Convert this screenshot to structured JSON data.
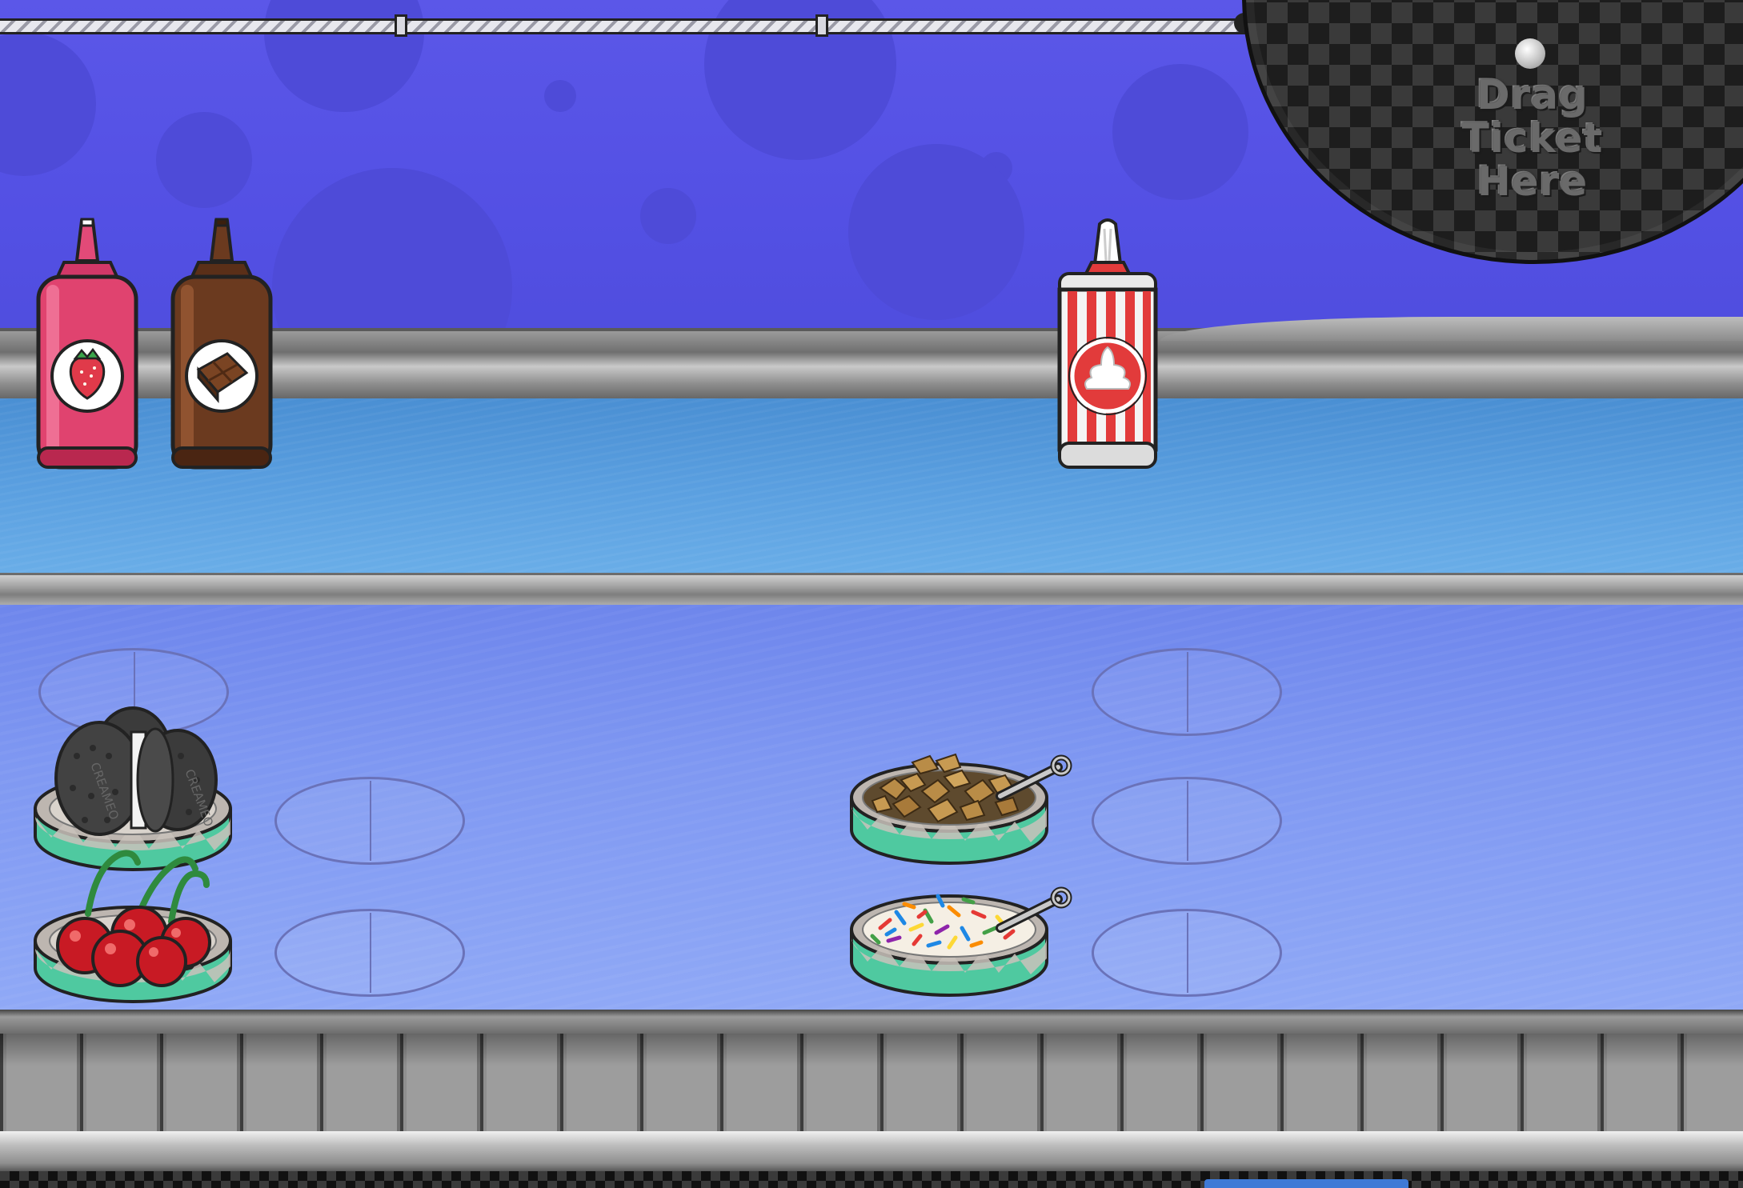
{
  "dropzone": {
    "label": "Drag\nTicket\nHere"
  },
  "sauces": [
    {
      "name": "strawberry-syrup",
      "icon": "strawberry-icon",
      "color": "#e0436f"
    },
    {
      "name": "chocolate-syrup",
      "icon": "chocolate-bar-icon",
      "color": "#6b3a1f"
    }
  ],
  "whipped_cream": {
    "icon": "whipped-cream-icon",
    "color": "#e23b3b"
  },
  "toppings": [
    {
      "name": "creameo-cookies",
      "label": "CREAMEO"
    },
    {
      "name": "cherries"
    },
    {
      "name": "nuts"
    },
    {
      "name": "sprinkles"
    }
  ],
  "colors": {
    "wall": "#5a56e6",
    "counter": "#7f98f2",
    "bin_band": "#4fc9a0"
  }
}
